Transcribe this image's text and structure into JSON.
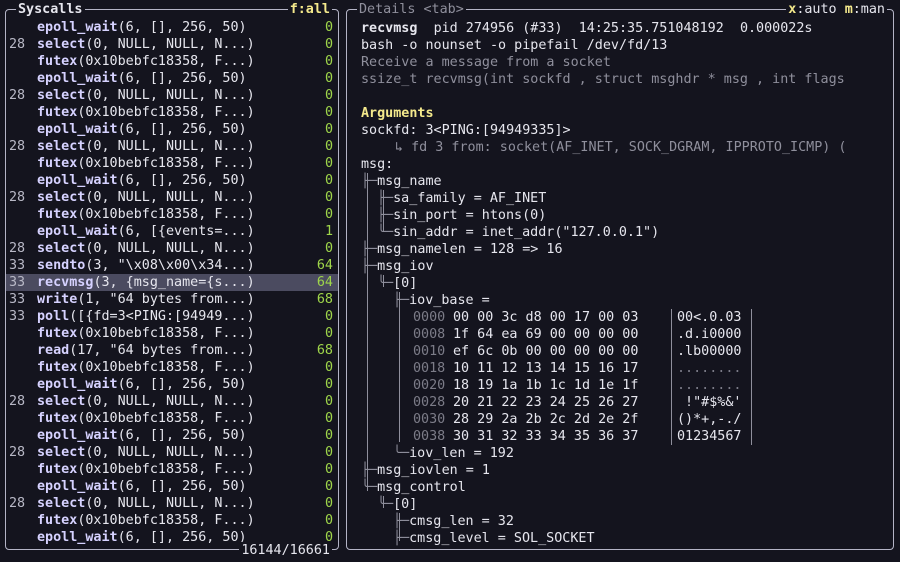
{
  "syscalls_panel": {
    "title": "Syscalls",
    "filter": "f:all",
    "position": "16144/16661",
    "rows": [
      {
        "tid": "",
        "name": "epoll_wait",
        "args": "(6, [], 256, 50)",
        "ret": "0"
      },
      {
        "tid": "28",
        "name": "select",
        "args": "(0, NULL, NULL, N...)",
        "ret": "0"
      },
      {
        "tid": "",
        "name": "futex",
        "args": "(0x10bebfc18358, F...)",
        "ret": "0"
      },
      {
        "tid": "",
        "name": "epoll_wait",
        "args": "(6, [], 256, 50)",
        "ret": "0"
      },
      {
        "tid": "28",
        "name": "select",
        "args": "(0, NULL, NULL, N...)",
        "ret": "0"
      },
      {
        "tid": "",
        "name": "futex",
        "args": "(0x10bebfc18358, F...)",
        "ret": "0"
      },
      {
        "tid": "",
        "name": "epoll_wait",
        "args": "(6, [], 256, 50)",
        "ret": "0"
      },
      {
        "tid": "28",
        "name": "select",
        "args": "(0, NULL, NULL, N...)",
        "ret": "0"
      },
      {
        "tid": "",
        "name": "futex",
        "args": "(0x10bebfc18358, F...)",
        "ret": "0"
      },
      {
        "tid": "",
        "name": "epoll_wait",
        "args": "(6, [], 256, 50)",
        "ret": "0"
      },
      {
        "tid": "28",
        "name": "select",
        "args": "(0, NULL, NULL, N...)",
        "ret": "0"
      },
      {
        "tid": "",
        "name": "futex",
        "args": "(0x10bebfc18358, F...)",
        "ret": "0"
      },
      {
        "tid": "",
        "name": "epoll_wait",
        "args": "(6, [{events=...)",
        "ret": "1"
      },
      {
        "tid": "28",
        "name": "select",
        "args": "(0, NULL, NULL, N...)",
        "ret": "0"
      },
      {
        "tid": "33",
        "name": "sendto",
        "args": "(3, \"\\x08\\x00\\x34...)",
        "ret": "64"
      },
      {
        "tid": "33",
        "name": "recvmsg",
        "args": "(3, {msg_name={s...)",
        "ret": "64",
        "selected": true
      },
      {
        "tid": "33",
        "name": "write",
        "args": "(1, \"64 bytes from...)",
        "ret": "68"
      },
      {
        "tid": "33",
        "name": "poll",
        "args": "([{fd=3<PING:[94949...)",
        "ret": "0"
      },
      {
        "tid": "",
        "name": "futex",
        "args": "(0x10bebfc18358, F...)",
        "ret": "0"
      },
      {
        "tid": "",
        "name": "read",
        "args": "(17, \"64 bytes from...)",
        "ret": "68"
      },
      {
        "tid": "",
        "name": "futex",
        "args": "(0x10bebfc18358, F...)",
        "ret": "0"
      },
      {
        "tid": "",
        "name": "epoll_wait",
        "args": "(6, [], 256, 50)",
        "ret": "0"
      },
      {
        "tid": "28",
        "name": "select",
        "args": "(0, NULL, NULL, N...)",
        "ret": "0"
      },
      {
        "tid": "",
        "name": "futex",
        "args": "(0x10bebfc18358, F...)",
        "ret": "0"
      },
      {
        "tid": "",
        "name": "epoll_wait",
        "args": "(6, [], 256, 50)",
        "ret": "0"
      },
      {
        "tid": "28",
        "name": "select",
        "args": "(0, NULL, NULL, N...)",
        "ret": "0"
      },
      {
        "tid": "",
        "name": "futex",
        "args": "(0x10bebfc18358, F...)",
        "ret": "0"
      },
      {
        "tid": "",
        "name": "epoll_wait",
        "args": "(6, [], 256, 50)",
        "ret": "0"
      },
      {
        "tid": "28",
        "name": "select",
        "args": "(0, NULL, NULL, N...)",
        "ret": "0"
      },
      {
        "tid": "",
        "name": "futex",
        "args": "(0x10bebfc18358, F...)",
        "ret": "0"
      },
      {
        "tid": "",
        "name": "epoll_wait",
        "args": "(6, [], 256, 50)",
        "ret": "0"
      }
    ]
  },
  "details_panel": {
    "title": "Details",
    "tab_hint": "<tab>",
    "x_key": "x",
    "x_value": ":auto",
    "m_key": "m",
    "m_value": ":man",
    "header": {
      "syscall": "recvmsg",
      "pid_info": "pid 274956 (#33)",
      "timestamp": "14:25:35.751048192",
      "duration": "0.000022s"
    },
    "command": "bash -o nounset -o pipefail /dev/fd/13",
    "description": "Receive a message from a socket",
    "signature": "ssize_t recvmsg(int sockfd , struct msghdr * msg , int flags",
    "arguments_heading": "Arguments",
    "sockfd_label": "sockfd:",
    "sockfd_value": "3<PING:[94949335]>",
    "fd_origin": "↳ fd 3 from: socket(AF_INET, SOCK_DGRAM, IPPROTO_ICMP) (",
    "msg_label": "msg:",
    "msg_name": "msg_name",
    "sa_family": "sa_family = AF_INET",
    "sin_port": "sin_port = htons(0)",
    "sin_addr": "sin_addr = inet_addr(\"127.0.0.1\")",
    "msg_namelen": "msg_namelen = 128 => 16",
    "msg_iov": "msg_iov",
    "iov_index": "[0]",
    "iov_base": "iov_base =",
    "hexdump": [
      {
        "offset": "0000",
        "bytes": "00 00 3c d8 00 17 00 03",
        "ascii": "00<.0.03"
      },
      {
        "offset": "0008",
        "bytes": "1f 64 ea 69 00 00 00 00",
        "ascii": ".d.i0000"
      },
      {
        "offset": "0010",
        "bytes": "ef 6c 0b 00 00 00 00 00",
        "ascii": ".lb00000"
      },
      {
        "offset": "0018",
        "bytes": "10 11 12 13 14 15 16 17",
        "ascii": "........"
      },
      {
        "offset": "0020",
        "bytes": "18 19 1a 1b 1c 1d 1e 1f",
        "ascii": "........"
      },
      {
        "offset": "0028",
        "bytes": "20 21 22 23 24 25 26 27",
        "ascii": " !\"#$%&'"
      },
      {
        "offset": "0030",
        "bytes": "28 29 2a 2b 2c 2d 2e 2f",
        "ascii": "()*+,-./"
      },
      {
        "offset": "0038",
        "bytes": "30 31 32 33 34 35 36 37",
        "ascii": "01234567"
      }
    ],
    "iov_len": "iov_len = 192",
    "msg_iovlen": "msg_iovlen = 1",
    "msg_control": "msg_control",
    "control_index": "[0]",
    "cmsg_len": "cmsg_len = 32",
    "cmsg_level": "cmsg_level = SOL_SOCKET"
  }
}
